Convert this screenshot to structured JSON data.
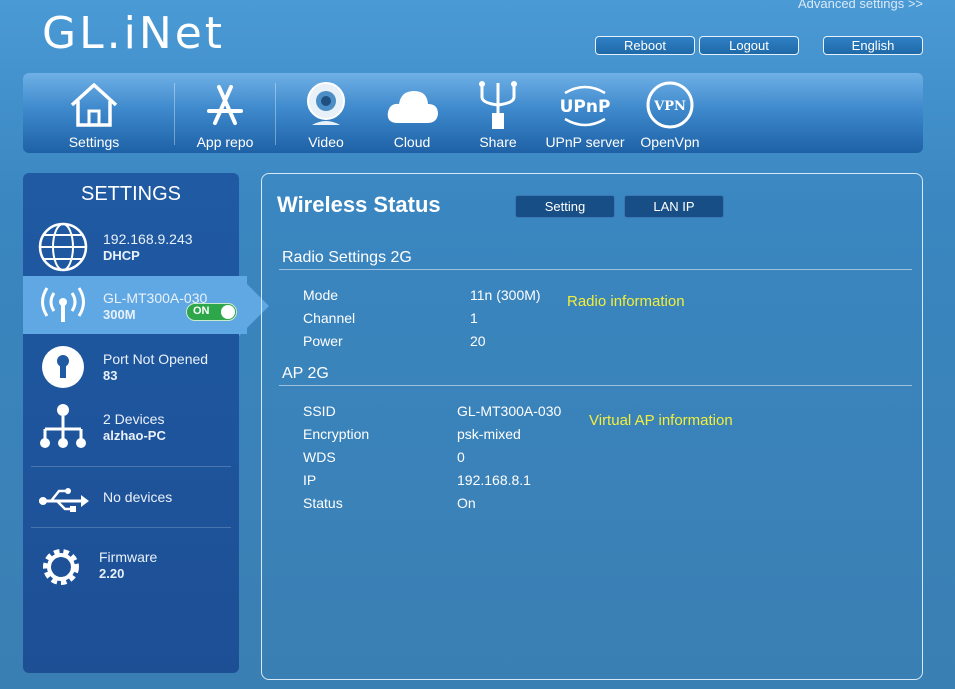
{
  "header": {
    "logo_text": "GL.iNet",
    "advanced_link": "Advanced settings >>",
    "reboot_label": "Reboot",
    "logout_label": "Logout",
    "language_label": "English"
  },
  "nav": {
    "items": [
      {
        "label": "Settings",
        "icon": "home-icon"
      },
      {
        "label": "App repo",
        "icon": "app-store-icon"
      },
      {
        "label": "Video",
        "icon": "webcam-icon"
      },
      {
        "label": "Cloud",
        "icon": "cloud-icon"
      },
      {
        "label": "Share",
        "icon": "usb-share-icon"
      },
      {
        "label": "UPnP server",
        "icon": "upnp-icon"
      },
      {
        "label": "OpenVpn",
        "icon": "vpn-icon"
      }
    ],
    "upnp_icon_text": "UPnP",
    "vpn_icon_text": "VPN"
  },
  "sidebar": {
    "title": "SETTINGS",
    "rows": [
      {
        "line1": "192.168.9.243",
        "line2": "DHCP",
        "icon": "globe-icon"
      },
      {
        "line1": "GL-MT300A-030",
        "line2": "300M",
        "icon": "wifi-icon",
        "toggle": "ON"
      },
      {
        "line1": "Port Not Opened",
        "line2": "83",
        "icon": "keyhole-icon"
      },
      {
        "line1": "2 Devices",
        "line2": "alzhao-PC",
        "icon": "network-tree-icon"
      },
      {
        "line1": "No devices",
        "line2": "",
        "icon": "usb-icon"
      },
      {
        "line1": "Firmware",
        "line2": "2.20",
        "icon": "gear-icon"
      }
    ]
  },
  "main": {
    "title": "Wireless Status",
    "setting_button": "Setting",
    "lanip_button": "LAN IP",
    "radio": {
      "title": "Radio Settings 2G",
      "note": "Radio information",
      "rows": [
        {
          "key": "Mode",
          "value": "11n (300M)"
        },
        {
          "key": "Channel",
          "value": "1"
        },
        {
          "key": "Power",
          "value": "20"
        }
      ]
    },
    "ap": {
      "title": "AP 2G",
      "note": "Virtual AP information",
      "rows": [
        {
          "key": "SSID",
          "value": "GL-MT300A-030"
        },
        {
          "key": "Encryption",
          "value": "psk-mixed"
        },
        {
          "key": "WDS",
          "value": "0"
        },
        {
          "key": "IP",
          "value": "192.168.8.1"
        },
        {
          "key": "Status",
          "value": "On"
        }
      ]
    }
  }
}
